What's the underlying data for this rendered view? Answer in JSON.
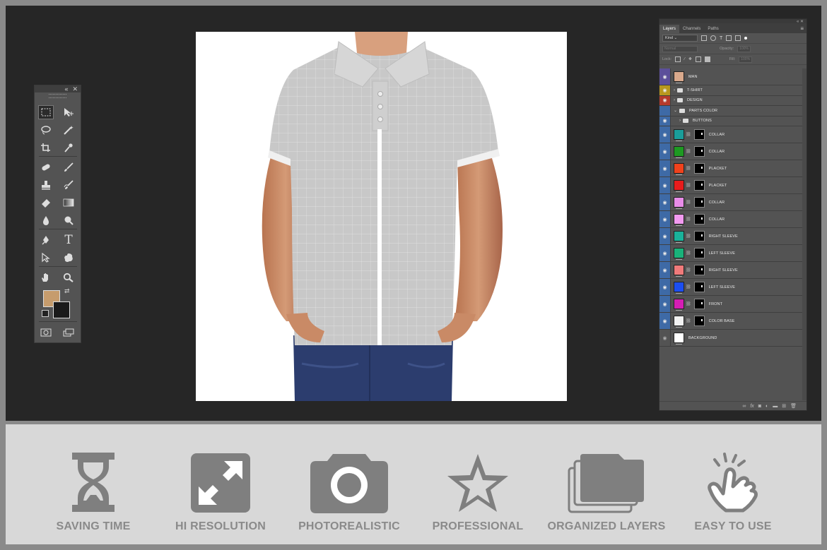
{
  "colors": {
    "workspace_bg": "#262626",
    "panel_bg": "#535353",
    "eye_selected": "#3e6aa6",
    "feature_icon": "#7f7f7f",
    "feature_bg": "#d8d8d8",
    "foreground_swatch": "#c69c6d",
    "background_swatch": "#1a1a1a"
  },
  "toolbox": {
    "header_icons": [
      "collapse-icon",
      "close-icon"
    ],
    "tools": [
      "rectangular-marquee-icon",
      "move-icon",
      "lasso-icon",
      "magic-wand-icon",
      "crop-icon",
      "eyedropper-icon",
      "healing-brush-icon",
      "brush-icon",
      "clone-stamp-icon",
      "history-brush-icon",
      "eraser-icon",
      "gradient-icon",
      "blur-icon",
      "dodge-icon",
      "pen-icon",
      "type-icon",
      "path-selection-icon",
      "custom-shape-icon",
      "hand-icon",
      "zoom-icon"
    ],
    "type_glyph": "T"
  },
  "layers_panel": {
    "tabs": [
      "Layers",
      "Channels",
      "Paths"
    ],
    "kind_label": "Kind",
    "blend_mode": "Normal",
    "opacity_label": "Opacity:",
    "opacity_value": "100%",
    "lock_label": "Lock:",
    "fill_label": "Fill:",
    "fill_value": "100%",
    "layers": [
      {
        "name": "MAN",
        "eye": "purple",
        "type": "image",
        "thumb": "#d9a98c"
      },
      {
        "name": "T-SHIRT",
        "eye": "yellow",
        "type": "group"
      },
      {
        "name": "DESIGN",
        "eye": "red",
        "type": "group"
      },
      {
        "name": "PARTS COLOR",
        "eye": "blue-hidden",
        "type": "group-open"
      },
      {
        "name": "BUTTONS",
        "eye": "blue",
        "type": "group-nested"
      },
      {
        "name": "COLLAR",
        "eye": "blue",
        "type": "fill",
        "thumb": "#1a9d9a"
      },
      {
        "name": "COLLAR",
        "eye": "blue",
        "type": "fill",
        "thumb": "#1e9a22"
      },
      {
        "name": "PLACKET",
        "eye": "blue",
        "type": "fill",
        "thumb": "#f0421c"
      },
      {
        "name": "PLACKET",
        "eye": "blue",
        "type": "fill",
        "thumb": "#e81c1c"
      },
      {
        "name": "COLLAR",
        "eye": "blue",
        "type": "fill",
        "thumb": "#e88ce8"
      },
      {
        "name": "COLLAR",
        "eye": "blue",
        "type": "fill",
        "thumb": "#f29af0"
      },
      {
        "name": "RIGHT SLEEVE",
        "eye": "blue",
        "type": "fill",
        "thumb": "#1ab29a"
      },
      {
        "name": "LEFT SLEEVE",
        "eye": "blue",
        "type": "fill",
        "thumb": "#19b27a"
      },
      {
        "name": "RIGHT SLEEVE",
        "eye": "blue",
        "type": "fill",
        "thumb": "#f07a7a"
      },
      {
        "name": "LEFT SLEEVE",
        "eye": "blue",
        "type": "fill",
        "thumb": "#1c4ef0"
      },
      {
        "name": "FRONT",
        "eye": "blue",
        "type": "fill",
        "thumb": "#d61eb4"
      },
      {
        "name": "COLOR BASE",
        "eye": "blue",
        "type": "fill",
        "thumb": "#f2f2f2"
      },
      {
        "name": "BACKGROUND",
        "eye": "gray",
        "type": "image",
        "thumb": "#ffffff"
      }
    ]
  },
  "features": [
    {
      "label": "SAVING TIME",
      "icon": "hourglass-icon"
    },
    {
      "label": "HI RESOLUTION",
      "icon": "expand-arrows-icon"
    },
    {
      "label": "PHOTOREALISTIC",
      "icon": "camera-icon"
    },
    {
      "label": "PROFESSIONAL",
      "icon": "star-icon"
    },
    {
      "label": "ORGANIZED LAYERS",
      "icon": "folders-icon"
    },
    {
      "label": "EASY TO USE",
      "icon": "tap-hand-icon"
    }
  ]
}
